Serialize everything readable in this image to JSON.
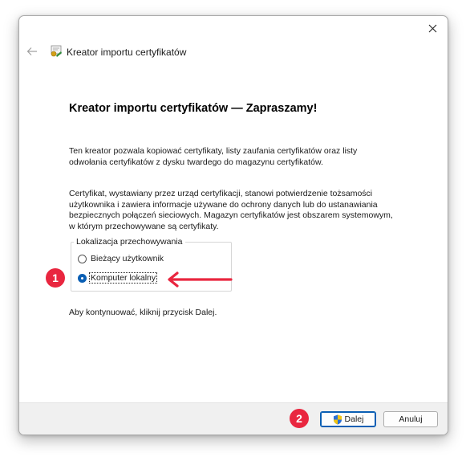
{
  "window": {
    "title": "Kreator importu certyfikatów"
  },
  "content": {
    "heading": "Kreator importu certyfikatów — Zapraszamy!",
    "intro_lines": [
      "Ten kreator pozwala kopiować certyfikaty, listy zaufania certyfikatów oraz listy",
      "odwołania certyfikatów z dysku twardego do magazynu certyfikatów."
    ],
    "description_lines": [
      "Certyfikat, wystawiany przez urząd certyfikacji, stanowi potwierdzenie tożsamości",
      "użytkownika i zawiera informacje używane do ochrony danych lub do ustanawiania",
      "bezpiecznych połączeń sieciowych. Magazyn certyfikatów jest obszarem systemowym,",
      "w którym przechowywane są certyfikaty."
    ],
    "continue_text": "Aby kontynuować, kliknij przycisk Dalej."
  },
  "store_location": {
    "legend": "Lokalizacja przechowywania",
    "options": [
      {
        "label": "Bieżący użytkownik",
        "selected": false
      },
      {
        "label": "Komputer lokalny",
        "selected": true
      }
    ]
  },
  "footer": {
    "next_label": "Dalej",
    "cancel_label": "Anuluj"
  },
  "annotations": {
    "marker_1": "1",
    "marker_2": "2",
    "color": "#e9263f"
  },
  "colors": {
    "accent": "#0a5fb4",
    "footer_bg": "#f0f0f0"
  },
  "icons": {
    "back": "arrow-left-icon",
    "close": "close-icon",
    "app": "certificate-icon",
    "uac": "uac-shield-icon"
  }
}
